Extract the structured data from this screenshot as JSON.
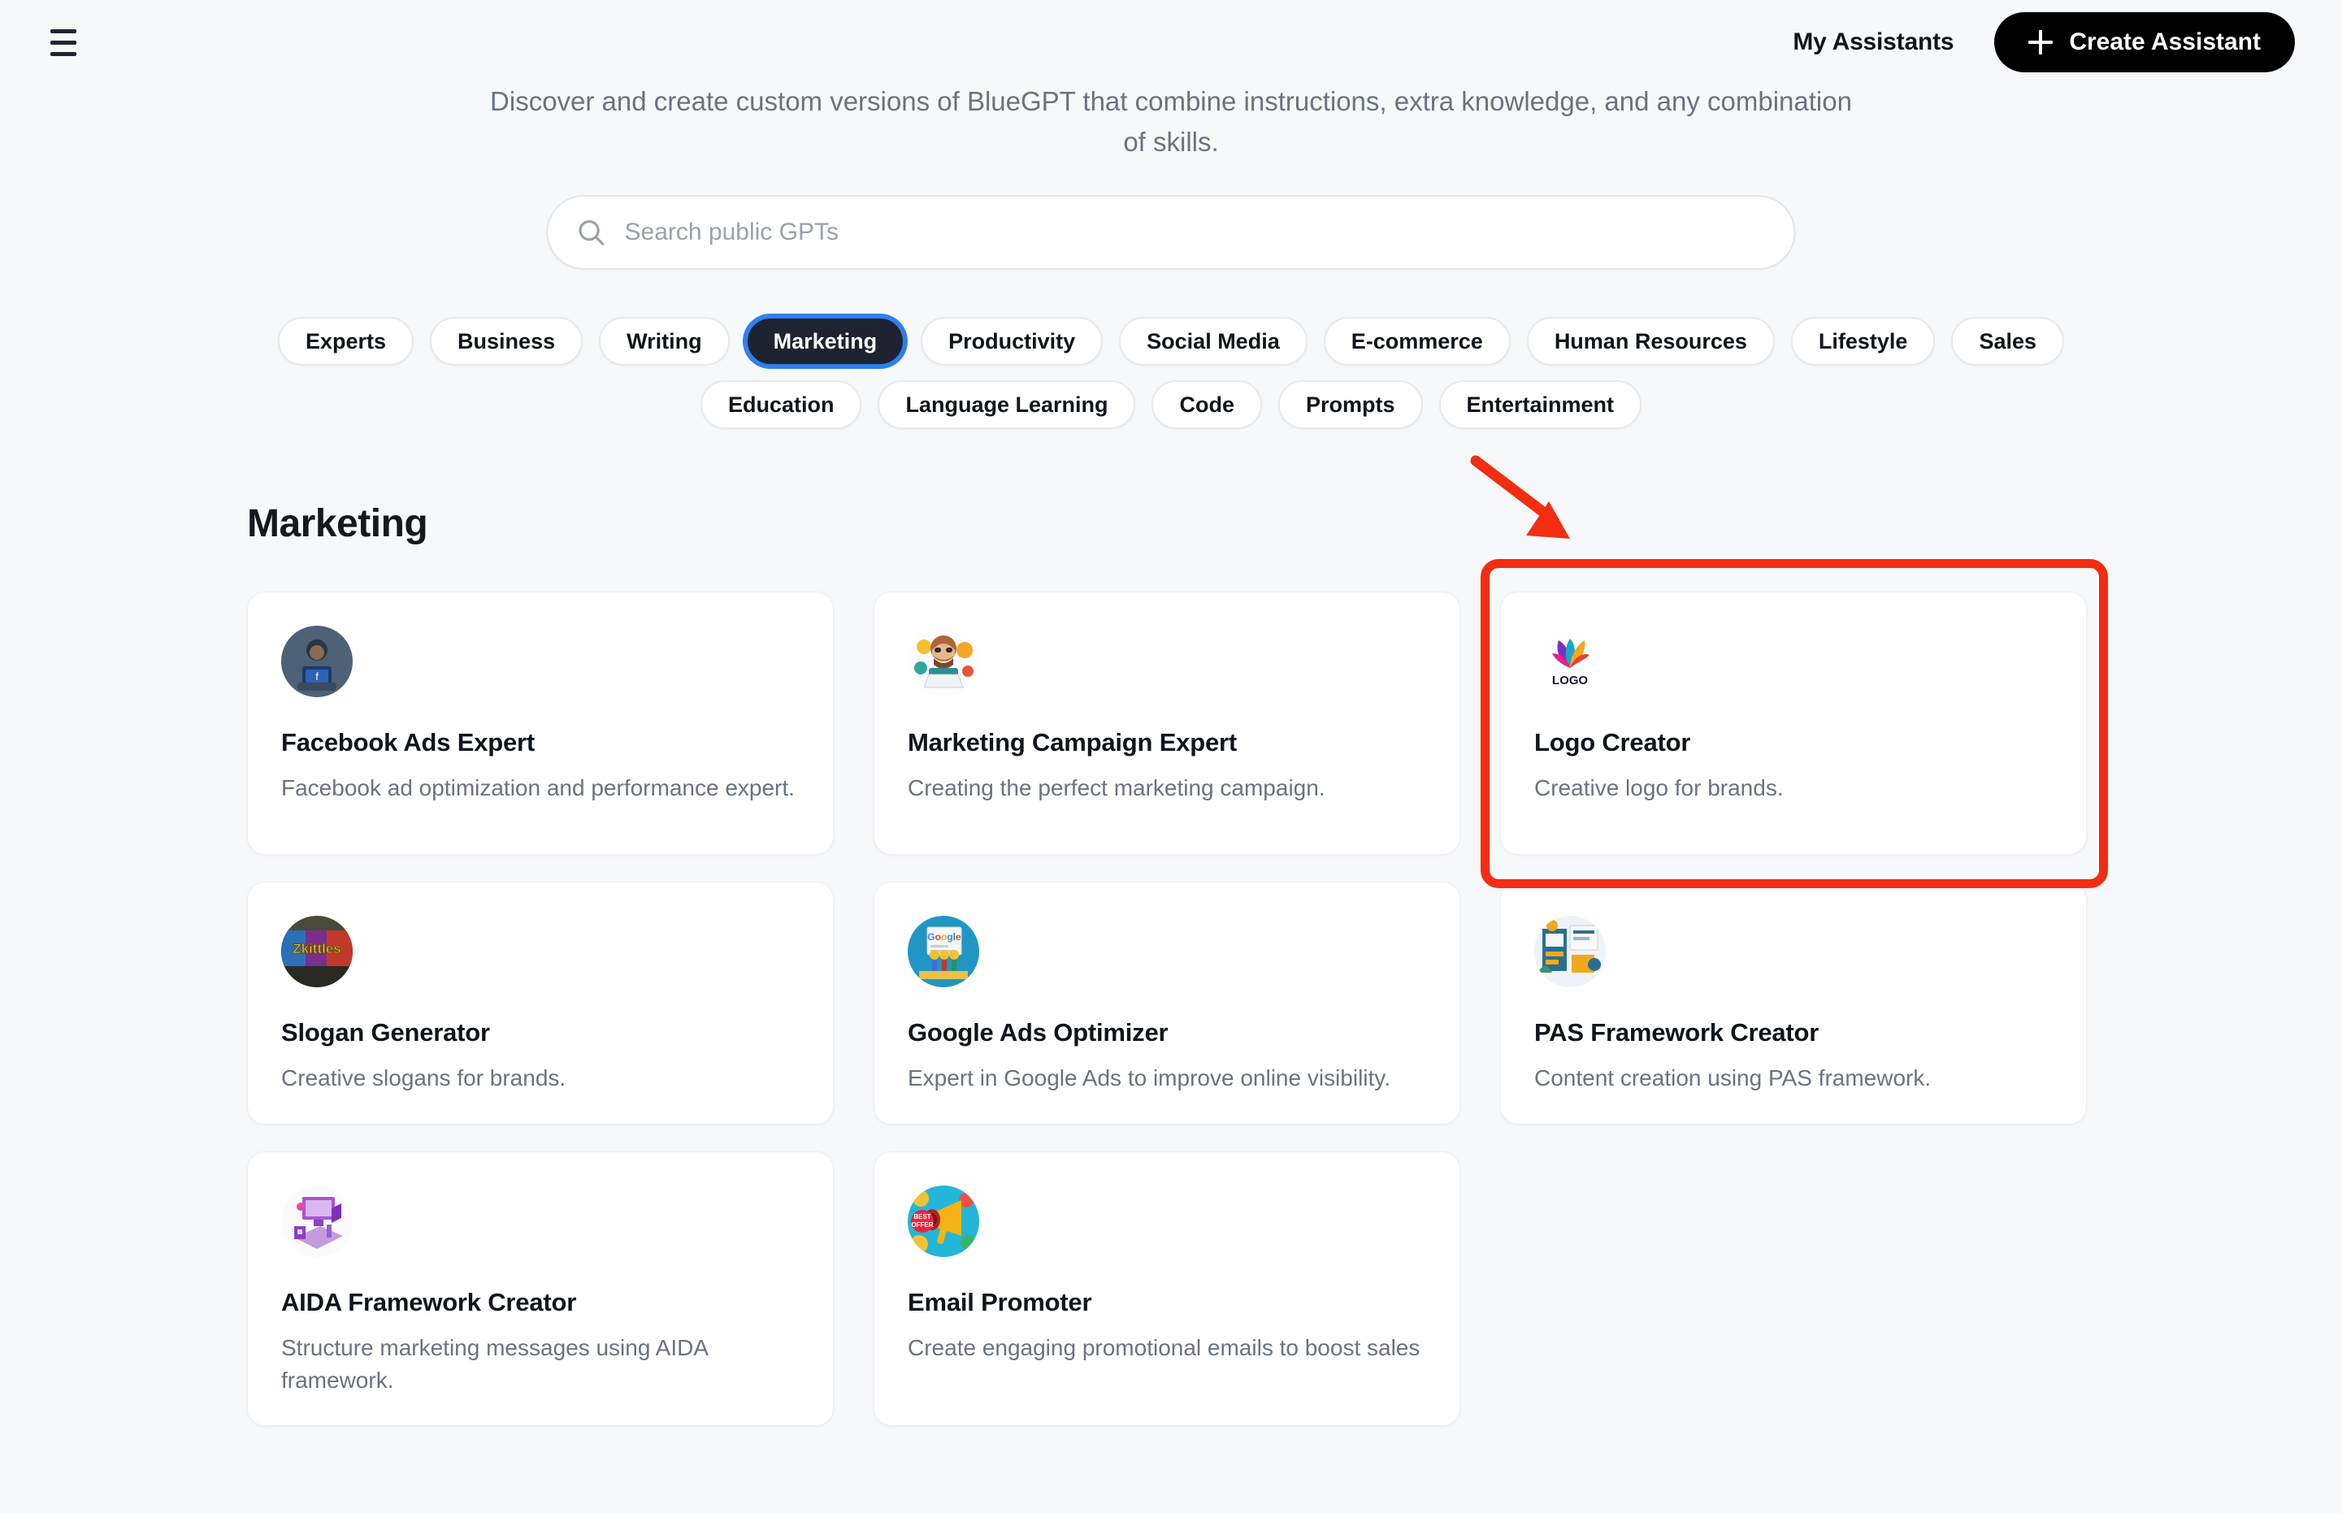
{
  "header": {
    "menu_icon": "hamburger-icon",
    "my_assistants_label": "My Assistants",
    "create_assistant_label": "Create Assistant",
    "plus_icon": "plus-icon"
  },
  "subtitle": "Discover and create custom versions of BlueGPT that combine instructions, extra knowledge, and any combination of skills.",
  "search": {
    "placeholder": "Search public GPTs",
    "value": "",
    "icon": "search-icon"
  },
  "categories": [
    {
      "label": "Experts",
      "active": false
    },
    {
      "label": "Business",
      "active": false
    },
    {
      "label": "Writing",
      "active": false
    },
    {
      "label": "Marketing",
      "active": true
    },
    {
      "label": "Productivity",
      "active": false
    },
    {
      "label": "Social Media",
      "active": false
    },
    {
      "label": "E-commerce",
      "active": false
    },
    {
      "label": "Human Resources",
      "active": false
    },
    {
      "label": "Lifestyle",
      "active": false
    },
    {
      "label": "Sales",
      "active": false
    },
    {
      "label": "Education",
      "active": false
    },
    {
      "label": "Language Learning",
      "active": false
    },
    {
      "label": "Code",
      "active": false
    },
    {
      "label": "Prompts",
      "active": false
    },
    {
      "label": "Entertainment",
      "active": false
    }
  ],
  "section": {
    "title": "Marketing"
  },
  "cards": [
    {
      "title": "Facebook Ads Expert",
      "description": "Facebook ad optimization and performance expert.",
      "avatar": "person-with-laptop-avatar"
    },
    {
      "title": "Marketing Campaign Expert",
      "description": "Creating the perfect marketing campaign.",
      "avatar": "bearded-marketer-avatar"
    },
    {
      "title": "Logo Creator",
      "description": "Creative logo for brands.",
      "avatar": "colorful-logo-avatar",
      "highlighted": true
    },
    {
      "title": "Slogan Generator",
      "description": "Creative slogans for brands.",
      "avatar": "graffiti-wall-avatar"
    },
    {
      "title": "Google Ads Optimizer",
      "description": "Expert in Google Ads to improve online visibility.",
      "avatar": "google-ads-board-avatar"
    },
    {
      "title": "PAS Framework Creator",
      "description": "Content creation using PAS framework.",
      "avatar": "content-workspace-avatar"
    },
    {
      "title": "AIDA Framework Creator",
      "description": "Structure marketing messages using AIDA framework.",
      "avatar": "purple-desk-avatar"
    },
    {
      "title": "Email Promoter",
      "description": "Create engaging promotional emails to boost sales",
      "avatar": "megaphone-avatar"
    }
  ],
  "annotations": {
    "arrow": "red-arrow-pointing-to-logo-creator",
    "highlight_box": "red-highlight-box-around-logo-creator",
    "color": "#f32d12"
  },
  "colors": {
    "background": "#f7f8fa",
    "accent_blue": "#2f80ed",
    "pill_active_bg": "#1d2330",
    "annotation_red": "#f32d12"
  }
}
